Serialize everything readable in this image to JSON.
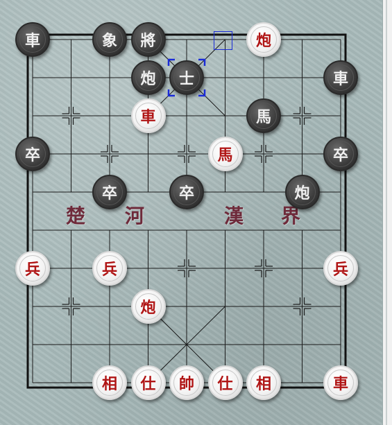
{
  "river": {
    "left": "楚",
    "left2": "河",
    "right": "漢",
    "right2": "界"
  },
  "colors": {
    "red_text": "#b01515",
    "black_piece": "#3a3a3a",
    "board": "#a8baba",
    "selection": "#1a2bd8"
  },
  "pieces": [
    {
      "name": "black-chariot",
      "char": "車",
      "side": "black",
      "col": 0,
      "row": 0
    },
    {
      "name": "black-elephant",
      "char": "象",
      "side": "black",
      "col": 2,
      "row": 0
    },
    {
      "name": "black-general",
      "char": "將",
      "side": "black",
      "col": 3,
      "row": 0
    },
    {
      "name": "red-cannon",
      "char": "炮",
      "side": "red",
      "col": 6,
      "row": 0
    },
    {
      "name": "black-cannon",
      "char": "炮",
      "side": "black",
      "col": 3,
      "row": 1
    },
    {
      "name": "black-advisor",
      "char": "士",
      "side": "black",
      "col": 4,
      "row": 1
    },
    {
      "name": "black-chariot",
      "char": "車",
      "side": "black",
      "col": 8,
      "row": 1
    },
    {
      "name": "red-chariot",
      "char": "車",
      "side": "red",
      "col": 3,
      "row": 2
    },
    {
      "name": "black-horse",
      "char": "馬",
      "side": "black",
      "col": 6,
      "row": 2
    },
    {
      "name": "black-soldier",
      "char": "卒",
      "side": "black",
      "col": 0,
      "row": 3
    },
    {
      "name": "red-horse",
      "char": "馬",
      "side": "red",
      "col": 5,
      "row": 3
    },
    {
      "name": "black-soldier",
      "char": "卒",
      "side": "black",
      "col": 8,
      "row": 3
    },
    {
      "name": "black-soldier",
      "char": "卒",
      "side": "black",
      "col": 2,
      "row": 4
    },
    {
      "name": "black-soldier",
      "char": "卒",
      "side": "black",
      "col": 4,
      "row": 4
    },
    {
      "name": "black-cannon",
      "char": "炮",
      "side": "black",
      "col": 7,
      "row": 4
    },
    {
      "name": "red-soldier",
      "char": "兵",
      "side": "red",
      "col": 0,
      "row": 6
    },
    {
      "name": "red-soldier",
      "char": "兵",
      "side": "red",
      "col": 2,
      "row": 6
    },
    {
      "name": "red-soldier",
      "char": "兵",
      "side": "red",
      "col": 8,
      "row": 6
    },
    {
      "name": "red-cannon",
      "char": "炮",
      "side": "red",
      "col": 3,
      "row": 7
    },
    {
      "name": "red-elephant",
      "char": "相",
      "side": "red",
      "col": 2,
      "row": 9
    },
    {
      "name": "red-advisor",
      "char": "仕",
      "side": "red",
      "col": 3,
      "row": 9
    },
    {
      "name": "red-general",
      "char": "帥",
      "side": "red",
      "col": 4,
      "row": 9
    },
    {
      "name": "red-advisor",
      "char": "仕",
      "side": "red",
      "col": 5,
      "row": 9
    },
    {
      "name": "red-elephant",
      "char": "相",
      "side": "red",
      "col": 6,
      "row": 9
    },
    {
      "name": "red-chariot",
      "char": "車",
      "side": "red",
      "col": 8,
      "row": 9
    }
  ]
}
